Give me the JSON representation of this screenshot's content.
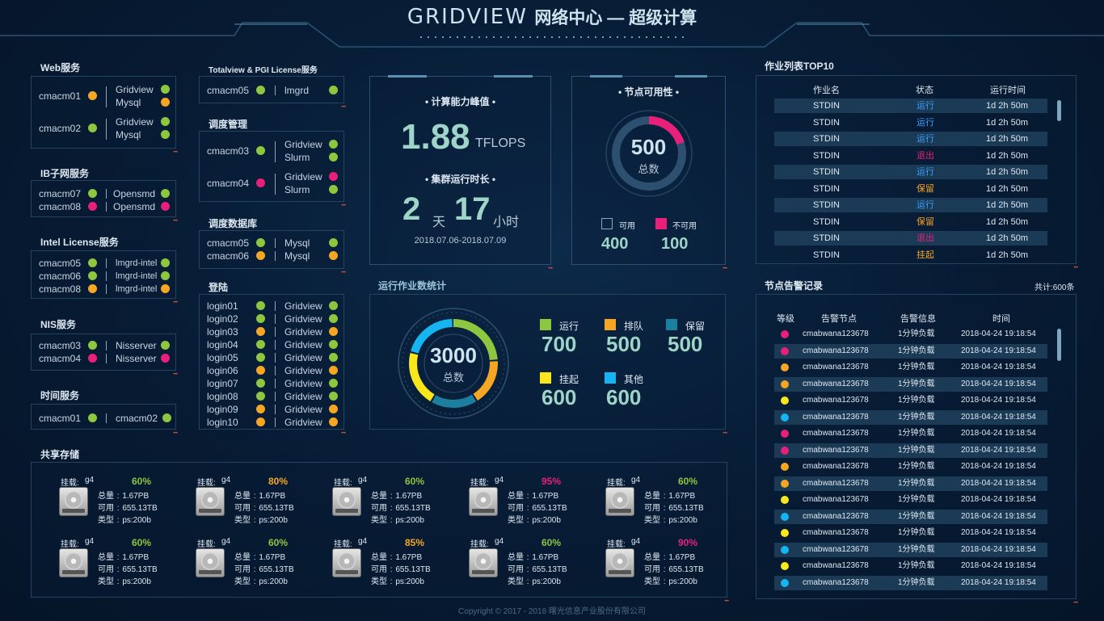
{
  "header": {
    "brand": "GRIDVIEW",
    "title": "网络中心 — 超级计算"
  },
  "web": {
    "title": "Web服务",
    "groups": [
      {
        "node": "cmacm01",
        "status": "o",
        "services": [
          {
            "name": "Gridview",
            "status": "g"
          },
          {
            "name": "Mysql",
            "status": "o"
          }
        ]
      },
      {
        "node": "cmacm02",
        "status": "g",
        "services": [
          {
            "name": "Gridview",
            "status": "g"
          },
          {
            "name": "Mysql",
            "status": "g"
          }
        ]
      }
    ]
  },
  "ib": {
    "title": "IB子网服务",
    "rows": [
      {
        "node": "cmacm07",
        "ns": "g",
        "svc": "Opensmd",
        "ss": "g"
      },
      {
        "node": "cmacm08",
        "ns": "p",
        "svc": "Opensmd",
        "ss": "p"
      }
    ]
  },
  "intel": {
    "title": "Intel License服务",
    "rows": [
      {
        "node": "cmacm05",
        "ns": "g",
        "svc": "lmgrd-intel",
        "ss": "g"
      },
      {
        "node": "cmacm06",
        "ns": "g",
        "svc": "lmgrd-intel",
        "ss": "g"
      },
      {
        "node": "cmacm08",
        "ns": "o",
        "svc": "lmgrd-intel",
        "ss": "o"
      }
    ]
  },
  "nis": {
    "title": "NIS服务",
    "rows": [
      {
        "node": "cmacm03",
        "ns": "g",
        "svc": "Nisserver",
        "ss": "g"
      },
      {
        "node": "cmacm04",
        "ns": "p",
        "svc": "Nisserver",
        "ss": "p"
      }
    ]
  },
  "time": {
    "title": "时间服务",
    "rows": [
      {
        "node": "cmacm01",
        "ns": "g",
        "svc": "cmacm02",
        "ss": "g"
      }
    ]
  },
  "totalview": {
    "title": "Totalview & PGI License服务",
    "rows": [
      {
        "node": "cmacm05",
        "ns": "g",
        "svc": "lmgrd",
        "ss": "g"
      }
    ]
  },
  "sched": {
    "title": "调度管理",
    "groups": [
      {
        "node": "cmacm03",
        "status": "g",
        "services": [
          {
            "name": "Gridview",
            "status": "g"
          },
          {
            "name": "Slurm",
            "status": "g"
          }
        ]
      },
      {
        "node": "cmacm04",
        "status": "p",
        "services": [
          {
            "name": "Gridview",
            "status": "p"
          },
          {
            "name": "Slurm",
            "status": "g"
          }
        ]
      }
    ]
  },
  "db": {
    "title": "调度数据库",
    "rows": [
      {
        "node": "cmacm05",
        "ns": "g",
        "svc": "Mysql",
        "ss": "g"
      },
      {
        "node": "cmacm06",
        "ns": "o",
        "svc": "Mysql",
        "ss": "o"
      }
    ]
  },
  "login": {
    "title": "登陆",
    "rows": [
      {
        "node": "login01",
        "ns": "g",
        "svc": "Gridview",
        "ss": "g"
      },
      {
        "node": "login02",
        "ns": "g",
        "svc": "Gridview",
        "ss": "g"
      },
      {
        "node": "login03",
        "ns": "o",
        "svc": "Gridview",
        "ss": "o"
      },
      {
        "node": "login04",
        "ns": "g",
        "svc": "Gridview",
        "ss": "g"
      },
      {
        "node": "login05",
        "ns": "g",
        "svc": "Gridview",
        "ss": "g"
      },
      {
        "node": "login06",
        "ns": "o",
        "svc": "Gridview",
        "ss": "o"
      },
      {
        "node": "login07",
        "ns": "g",
        "svc": "Gridview",
        "ss": "g"
      },
      {
        "node": "login08",
        "ns": "g",
        "svc": "Gridview",
        "ss": "g"
      },
      {
        "node": "login09",
        "ns": "o",
        "svc": "Gridview",
        "ss": "o"
      },
      {
        "node": "login10",
        "ns": "o",
        "svc": "Gridview",
        "ss": "o"
      }
    ]
  },
  "compute": {
    "title": "计算能力峰值",
    "value": "1.88",
    "unit": "TFLOPS",
    "runtime_title": "集群运行时长",
    "days": "2",
    "days_unit": "天",
    "hours": "17",
    "hours_unit": "小时",
    "range": "2018.07.06-2018.07.09"
  },
  "availability": {
    "title": "节点可用性",
    "total": "500",
    "total_label": "总数",
    "available_label": "可用",
    "unavailable_label": "不可用",
    "available": "400",
    "unavailable": "100",
    "unavailable_fraction": 0.2
  },
  "jobs": {
    "title": "运行作业数统计",
    "total": "3000",
    "total_label": "总数",
    "legend": [
      {
        "label": "运行",
        "value": "700",
        "color": "#8dc63f"
      },
      {
        "label": "排队",
        "value": "500",
        "color": "#f5a623"
      },
      {
        "label": "保留",
        "value": "500",
        "color": "#1d7fa0"
      },
      {
        "label": "挂起",
        "value": "600",
        "color": "#f8e71c"
      },
      {
        "label": "其他",
        "value": "600",
        "color": "#16b4f0"
      }
    ]
  },
  "top10": {
    "title": "作业列表TOP10",
    "headers": [
      "作业名",
      "状态",
      "运行时间"
    ],
    "rows": [
      {
        "name": "STDIN",
        "status": "运行",
        "color": "#3aa0ff",
        "time": "1d 2h 50m"
      },
      {
        "name": "STDIN",
        "status": "运行",
        "color": "#3aa0ff",
        "time": "1d 2h 50m"
      },
      {
        "name": "STDIN",
        "status": "运行",
        "color": "#3aa0ff",
        "time": "1d 2h 50m"
      },
      {
        "name": "STDIN",
        "status": "退出",
        "color": "#e8207a",
        "time": "1d 2h 50m"
      },
      {
        "name": "STDIN",
        "status": "运行",
        "color": "#3aa0ff",
        "time": "1d 2h 50m"
      },
      {
        "name": "STDIN",
        "status": "保留",
        "color": "#f5a623",
        "time": "1d 2h 50m"
      },
      {
        "name": "STDIN",
        "status": "运行",
        "color": "#3aa0ff",
        "time": "1d 2h 50m"
      },
      {
        "name": "STDIN",
        "status": "保留",
        "color": "#f5a623",
        "time": "1d 2h 50m"
      },
      {
        "name": "STDIN",
        "status": "退出",
        "color": "#e8207a",
        "time": "1d 2h 50m"
      },
      {
        "name": "STDIN",
        "status": "挂起",
        "color": "#f5a623",
        "time": "1d 2h 50m"
      }
    ]
  },
  "alerts": {
    "title": "节点告警记录",
    "total": "共计:600条",
    "headers": [
      "等级",
      "告警节点",
      "告警信息",
      "时间"
    ],
    "rows": [
      {
        "level": "p",
        "node": "cmabwana123678",
        "info": "1分钟负载",
        "time": "2018-04-24 19:18:54"
      },
      {
        "level": "p",
        "node": "cmabwana123678",
        "info": "1分钟负载",
        "time": "2018-04-24 19:18:54"
      },
      {
        "level": "o",
        "node": "cmabwana123678",
        "info": "1分钟负载",
        "time": "2018-04-24 19:18:54"
      },
      {
        "level": "o",
        "node": "cmabwana123678",
        "info": "1分钟负载",
        "time": "2018-04-24 19:18:54"
      },
      {
        "level": "y",
        "node": "cmabwana123678",
        "info": "1分钟负载",
        "time": "2018-04-24 19:18:54"
      },
      {
        "level": "b",
        "node": "cmabwana123678",
        "info": "1分钟负载",
        "time": "2018-04-24 19:18:54"
      },
      {
        "level": "p",
        "node": "cmabwana123678",
        "info": "1分钟负载",
        "time": "2018-04-24 19:18:54"
      },
      {
        "level": "p",
        "node": "cmabwana123678",
        "info": "1分钟负载",
        "time": "2018-04-24 19:18:54"
      },
      {
        "level": "o",
        "node": "cmabwana123678",
        "info": "1分钟负载",
        "time": "2018-04-24 19:18:54"
      },
      {
        "level": "o",
        "node": "cmabwana123678",
        "info": "1分钟负载",
        "time": "2018-04-24 19:18:54"
      },
      {
        "level": "y",
        "node": "cmabwana123678",
        "info": "1分钟负载",
        "time": "2018-04-24 19:18:54"
      },
      {
        "level": "b",
        "node": "cmabwana123678",
        "info": "1分钟负载",
        "time": "2018-04-24 19:18:54"
      },
      {
        "level": "y",
        "node": "cmabwana123678",
        "info": "1分钟负载",
        "time": "2018-04-24 19:18:54"
      },
      {
        "level": "b",
        "node": "cmabwana123678",
        "info": "1分钟负载",
        "time": "2018-04-24 19:18:54"
      },
      {
        "level": "y",
        "node": "cmabwana123678",
        "info": "1分钟负载",
        "time": "2018-04-24 19:18:54"
      },
      {
        "level": "b",
        "node": "cmabwana123678",
        "info": "1分钟负载",
        "time": "2018-04-24 19:18:54"
      }
    ]
  },
  "storage": {
    "title": "共享存储",
    "mount_label": "挂载:",
    "total_label": "总量",
    "avail_label": "可用",
    "type_label": "类型",
    "items": [
      {
        "mount": "g4",
        "pct": "60%",
        "color": "#8dc63f",
        "total": "1.67PB",
        "avail": "655.13TB",
        "type": "ps:200b"
      },
      {
        "mount": "g4",
        "pct": "80%",
        "color": "#f5a623",
        "total": "1.67PB",
        "avail": "655.13TB",
        "type": "ps:200b"
      },
      {
        "mount": "g4",
        "pct": "60%",
        "color": "#8dc63f",
        "total": "1.67PB",
        "avail": "655.13TB",
        "type": "ps:200b"
      },
      {
        "mount": "g4",
        "pct": "95%",
        "color": "#e8207a",
        "total": "1.67PB",
        "avail": "655.13TB",
        "type": "ps:200b"
      },
      {
        "mount": "g4",
        "pct": "60%",
        "color": "#8dc63f",
        "total": "1.67PB",
        "avail": "655.13TB",
        "type": "ps:200b"
      },
      {
        "mount": "g4",
        "pct": "60%",
        "color": "#8dc63f",
        "total": "1.67PB",
        "avail": "655.13TB",
        "type": "ps:200b"
      },
      {
        "mount": "g4",
        "pct": "60%",
        "color": "#8dc63f",
        "total": "1.67PB",
        "avail": "655.13TB",
        "type": "ps:200b"
      },
      {
        "mount": "g4",
        "pct": "85%",
        "color": "#f5a623",
        "total": "1.67PB",
        "avail": "655.13TB",
        "type": "ps:200b"
      },
      {
        "mount": "g4",
        "pct": "60%",
        "color": "#8dc63f",
        "total": "1.67PB",
        "avail": "655.13TB",
        "type": "ps:200b"
      },
      {
        "mount": "g4",
        "pct": "90%",
        "color": "#e8207a",
        "total": "1.67PB",
        "avail": "655.13TB",
        "type": "ps:200b"
      }
    ]
  },
  "footer": {
    "copyright": "Copyright © 2017 - 2018 曙光信息产业股份有限公司"
  }
}
